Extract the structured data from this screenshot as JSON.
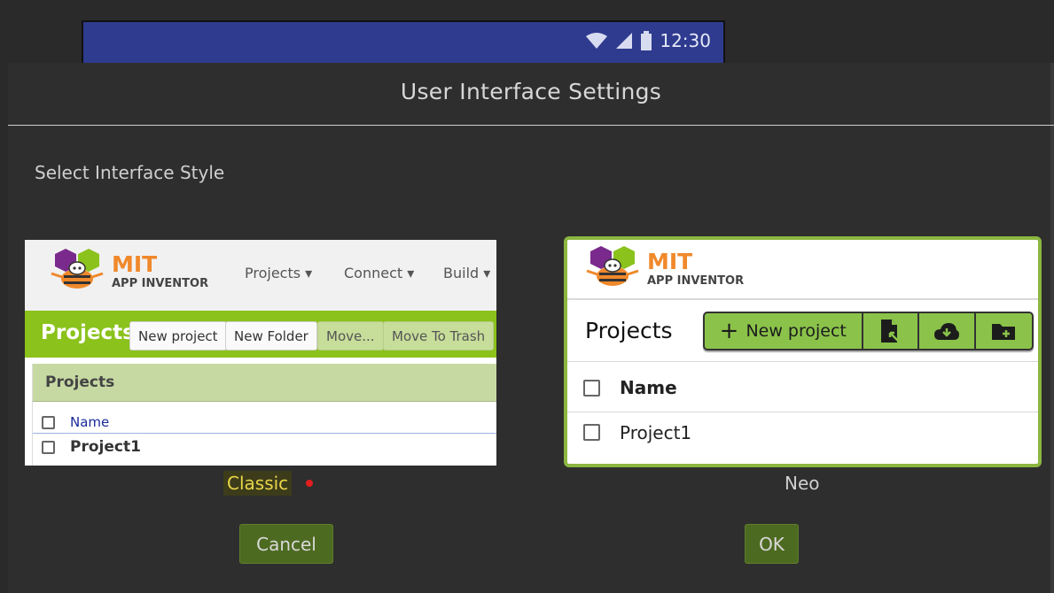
{
  "status_bar": {
    "time": "12:30",
    "icons": [
      "wifi-icon",
      "signal-icon",
      "battery-icon"
    ]
  },
  "dialog": {
    "title": "User Interface Settings",
    "subtitle": "Select Interface Style",
    "options": [
      {
        "id": "classic",
        "label": "Classic",
        "selected": true
      },
      {
        "id": "neo",
        "label": "Neo",
        "selected": false
      }
    ],
    "buttons": {
      "cancel": "Cancel",
      "ok": "OK"
    }
  },
  "classic_preview": {
    "logo_mit": "MIT",
    "logo_sub": "APP INVENTOR",
    "menu": [
      "Projects",
      "Connect",
      "Build"
    ],
    "heading": "Projects",
    "buttons": [
      "New project",
      "New Folder",
      "Move...",
      "Move To Trash"
    ],
    "panel_title": "Projects",
    "column_name": "Name",
    "rows": [
      "Project1"
    ]
  },
  "neo_preview": {
    "logo_mit": "MIT",
    "logo_sub": "APP INVENTOR",
    "heading": "Projects",
    "new_project": "New project",
    "column_name": "Name",
    "rows": [
      "Project1"
    ]
  },
  "colors": {
    "dialog_bg": "#2e2e2e",
    "accent_green": "#8bc21c",
    "button_green": "#4d6a21",
    "selected_label": "#e8d64a",
    "selection_dot": "#e21e1e",
    "neo_border": "#8bb640"
  }
}
